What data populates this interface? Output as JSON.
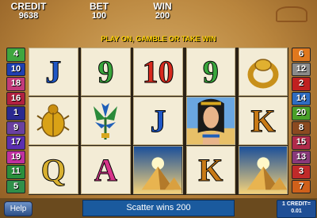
{
  "meters": {
    "credit_label": "CREDIT",
    "credit_value": "9638",
    "bet_label": "BET",
    "bet_value": "100",
    "win_label": "WIN",
    "win_value": "200"
  },
  "message": "PLAY ON, GAMBLE OR TAKE WIN",
  "left_lines": [
    "4",
    "10",
    "18",
    "16",
    "1",
    "9",
    "17",
    "19",
    "11",
    "5"
  ],
  "right_lines": [
    "6",
    "12",
    "2",
    "14",
    "20",
    "8",
    "15",
    "13",
    "3",
    "7"
  ],
  "line_colors": {
    "4": "#3fa63f",
    "10": "#1f3fb0",
    "18": "#c23a7a",
    "16": "#b02040",
    "1": "#2a2a90",
    "9": "#6a40a0",
    "17": "#5b2fb0",
    "19": "#c030a0",
    "11": "#2a8f3c",
    "5": "#2f8f4a",
    "6": "#e0781e",
    "12": "#8a8a8a",
    "2": "#c02020",
    "14": "#2f6cc0",
    "20": "#4a9f2a",
    "8": "#8b4a20",
    "15": "#b02a4a",
    "13": "#8a3a7a",
    "3": "#c02a2a",
    "7": "#d0601a"
  },
  "reels": [
    [
      "J",
      "scarab",
      "Q"
    ],
    [
      "9",
      "lotus",
      "A"
    ],
    [
      "10",
      "J",
      "pyramid"
    ],
    [
      "9",
      "cleopatra",
      "K"
    ],
    [
      "ring",
      "K",
      "pyramid"
    ]
  ],
  "symbol_colors": {
    "J": "#1f57c6",
    "Q": "#d8b030",
    "9": "#39a63c",
    "10": "#d82a1e",
    "A": "#d8348a",
    "K": "#c87a16"
  },
  "buttons": {
    "help_label": "Help"
  },
  "status": "Scatter wins 200",
  "denomination": {
    "line1": "1 CREDIT=",
    "line2": "0.01"
  }
}
